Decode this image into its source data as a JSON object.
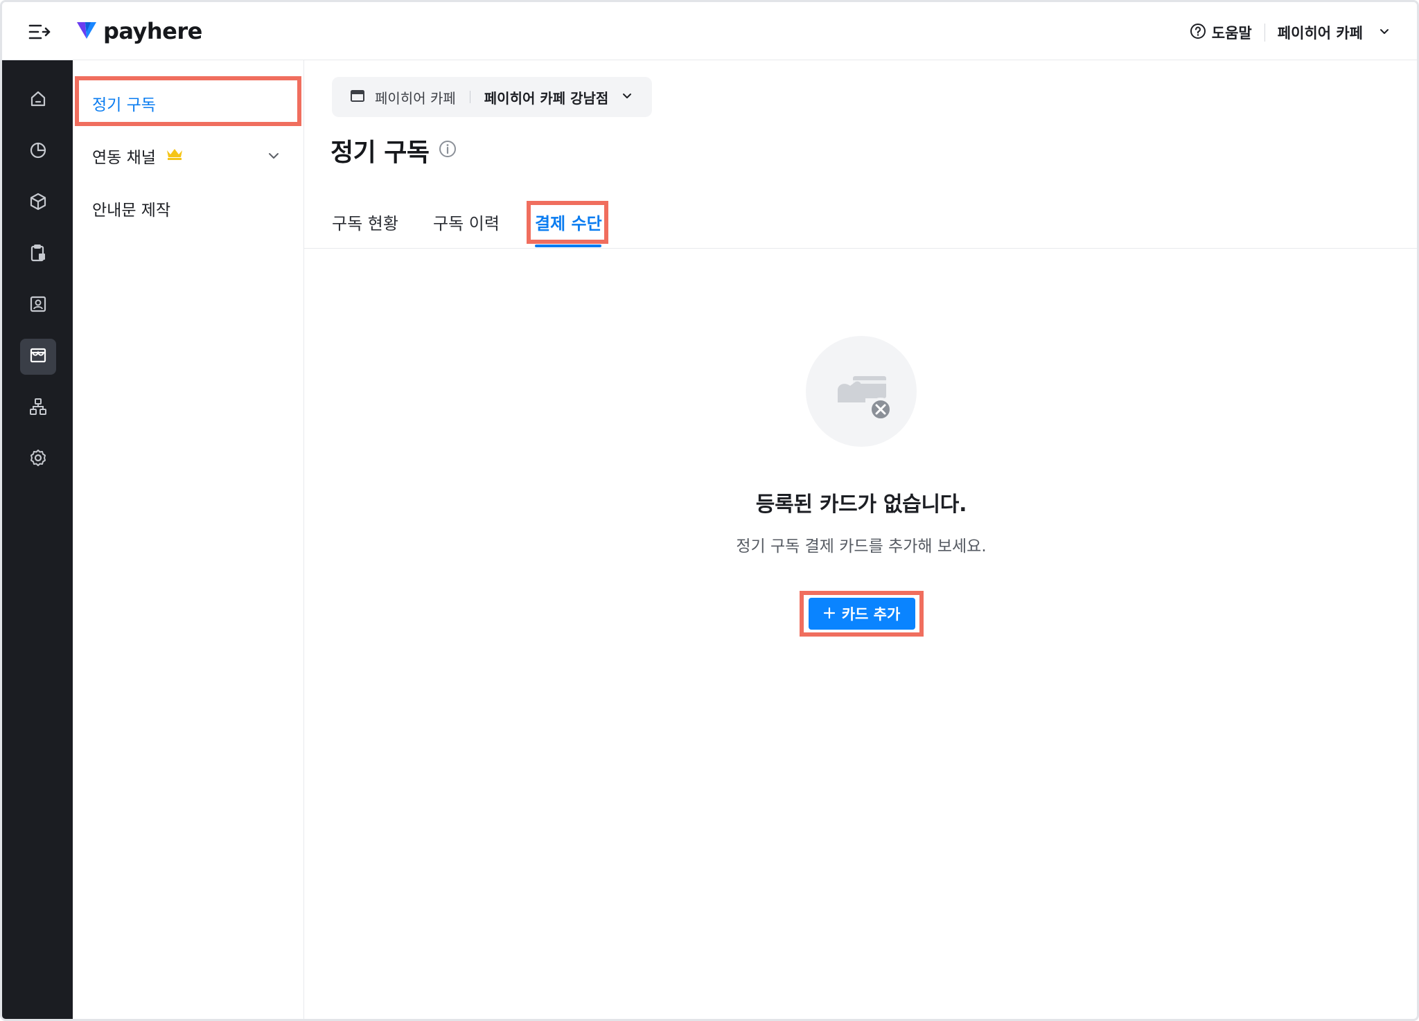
{
  "header": {
    "logo_text": "payhere",
    "help_label": "도움말",
    "store_name": "페이히어 카페"
  },
  "rail": {
    "items": [
      {
        "icon": "home-icon"
      },
      {
        "icon": "chart-pie-icon"
      },
      {
        "icon": "box-icon"
      },
      {
        "icon": "clipboard-icon"
      },
      {
        "icon": "contact-card-icon"
      },
      {
        "icon": "store-icon",
        "active": true
      },
      {
        "icon": "org-chart-icon"
      },
      {
        "icon": "settings-gear-icon"
      }
    ]
  },
  "subnav": {
    "items": [
      {
        "label": "정기 구독",
        "active": true
      },
      {
        "label": "연동 채널",
        "badge_icon": "crown-icon",
        "expandable": true
      },
      {
        "label": "안내문 제작"
      }
    ]
  },
  "store_selector": {
    "brand": "페이히어 카페",
    "branch": "페이히어 카페 강남점"
  },
  "page": {
    "title": "정기 구독"
  },
  "tabs": [
    {
      "label": "구독 현황"
    },
    {
      "label": "구독 이력"
    },
    {
      "label": "결제 수단",
      "active": true
    }
  ],
  "empty_state": {
    "icon": "card-missing-icon",
    "title": "등록된 카드가 없습니다.",
    "description": "정기 구독 결제 카드를 추가해 보세요.",
    "button_label": "카드 추가"
  },
  "colors": {
    "accent": "#0a84ff",
    "rail_bg": "#1b1d22",
    "highlight": "#f06e5e",
    "crown": "#f5c518"
  }
}
